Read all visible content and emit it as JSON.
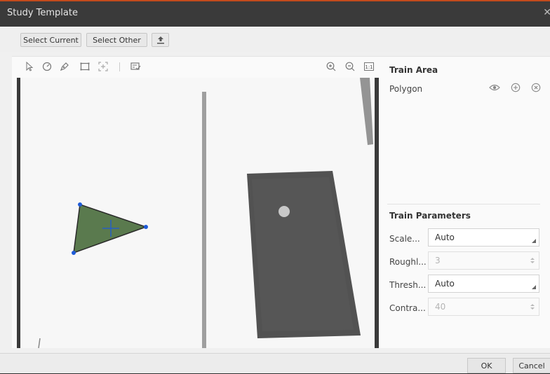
{
  "window": {
    "title": "Study Template"
  },
  "toolbar": {
    "select_current": "Select Current",
    "select_other": "Select Other"
  },
  "train_area": {
    "heading": "Train Area",
    "item_label": "Polygon"
  },
  "train_parameters": {
    "heading": "Train Parameters",
    "rows": [
      {
        "label": "Scale...",
        "value": "Auto",
        "control": "dropdown",
        "enabled": true
      },
      {
        "label": "Roughl...",
        "value": "3",
        "control": "spinner",
        "enabled": false
      },
      {
        "label": "Thresh...",
        "value": "Auto",
        "control": "dropdown",
        "enabled": true
      },
      {
        "label": "Contra...",
        "value": "40",
        "control": "spinner",
        "enabled": false
      }
    ]
  },
  "footer": {
    "ok": "OK",
    "cancel": "Cancel"
  },
  "colors": {
    "accent_line": "#c24a1c",
    "polygon_fill": "#5a7a4e",
    "vertex": "#1e5bd8"
  }
}
